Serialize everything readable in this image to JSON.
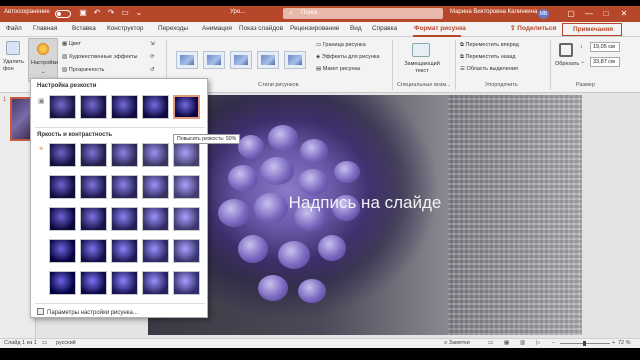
{
  "titlebar": {
    "autosave": "Автосохранение",
    "doc_title": "Уро...",
    "search_placeholder": "Поиск",
    "user": "Марина Викторовна Калинкина",
    "initials": "МВ"
  },
  "menu": {
    "items": [
      "Файл",
      "Главная",
      "Вставка",
      "Конструктор",
      "Переходы",
      "Анимация",
      "Показ слайдов",
      "Рецензирование",
      "Вид",
      "Справка",
      "Формат рисунка"
    ],
    "share": "Поделиться",
    "notes": "Примечания"
  },
  "ribbon": {
    "remove_bg": "Удалить фон",
    "corrections": "Настройки",
    "color": "Цвет",
    "artistic": "Художественные эффекты",
    "transparency": "Прозрачность",
    "border": "Граница рисунка",
    "effects": "Эффекты для рисунка",
    "layout": "Макет рисунка",
    "alt_text": "Замещающий текст",
    "forward": "Переместить вперед",
    "backward": "Переместить назад",
    "selection_pane": "Область выделения",
    "crop": "Обрезать",
    "height": "19,05 см",
    "width": "33,87 см",
    "group_styles": "Стили рисунков",
    "group_special": "Специальные возм...",
    "group_arrange": "Упорядочить",
    "group_size": "Размер"
  },
  "dropdown": {
    "sharpness_header": "Настройка резкости",
    "brightness_header": "Яркость и контрастность",
    "tooltip": "Повысить резкость: 50%",
    "footer": "Параметры настройки рисунка..."
  },
  "slide": {
    "number": "1",
    "caption": "Надпись на слайде"
  },
  "status": {
    "slide_of": "Слайд 1 из 1",
    "language": "русский",
    "notes": "Заметки",
    "zoom": "72 %"
  },
  "colors": {
    "accent": "#b7472a",
    "selection": "#e89b7a"
  }
}
